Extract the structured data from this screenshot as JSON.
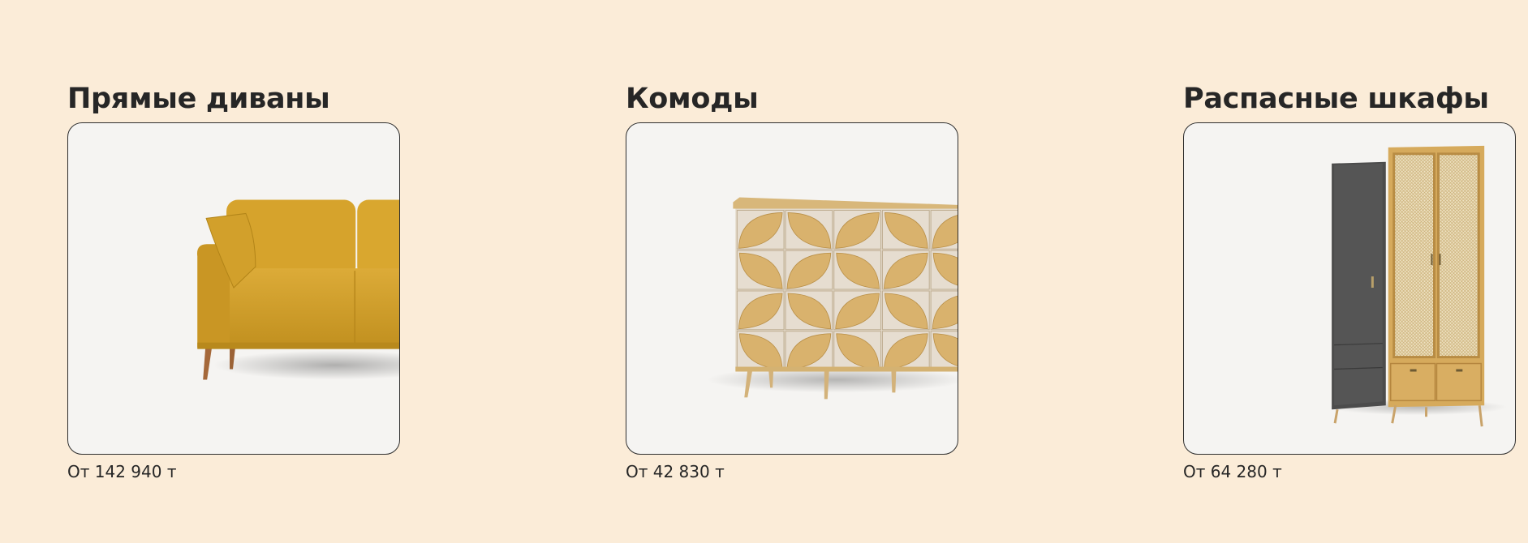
{
  "products": [
    {
      "title": "Прямые диваны",
      "price": "От 142 940 т",
      "image": "sofa-photo"
    },
    {
      "title": "Комоды",
      "price": "От 42 830 т",
      "image": "dresser-photo"
    },
    {
      "title": "Распасные шкафы",
      "price": "От 64 280 т",
      "image": "wardrobe-photo"
    }
  ],
  "colors": {
    "page_background": "#fbecd8",
    "card_background": "#f5f4f2",
    "card_border": "#2f2f2f",
    "text": "#262626"
  }
}
